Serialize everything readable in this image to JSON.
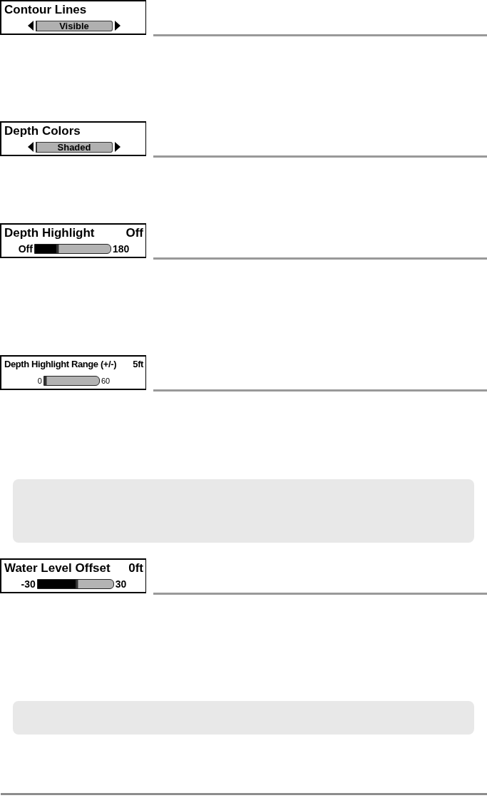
{
  "blocks": [
    {
      "kind": "selector",
      "title": "Contour Lines",
      "value": "Visible",
      "compact": false
    },
    {
      "kind": "selector",
      "title": "Depth Colors",
      "value": "Shaded",
      "compact": false
    },
    {
      "kind": "slider",
      "title": "Depth Highlight",
      "reading": "Off",
      "min_label": "Off",
      "max_label": "180",
      "level": 0.28,
      "compact": false
    },
    {
      "kind": "slider",
      "title": "Depth Highlight Range (+/-)",
      "reading": "5ft",
      "min_label": "0",
      "max_label": "60",
      "level": 0.0,
      "compact": true
    },
    {
      "kind": "note"
    },
    {
      "kind": "slider",
      "title": "Water Level Offset",
      "reading": "0ft",
      "min_label": "-30",
      "max_label": "30",
      "level": 0.5,
      "compact": false
    },
    {
      "kind": "note"
    }
  ]
}
